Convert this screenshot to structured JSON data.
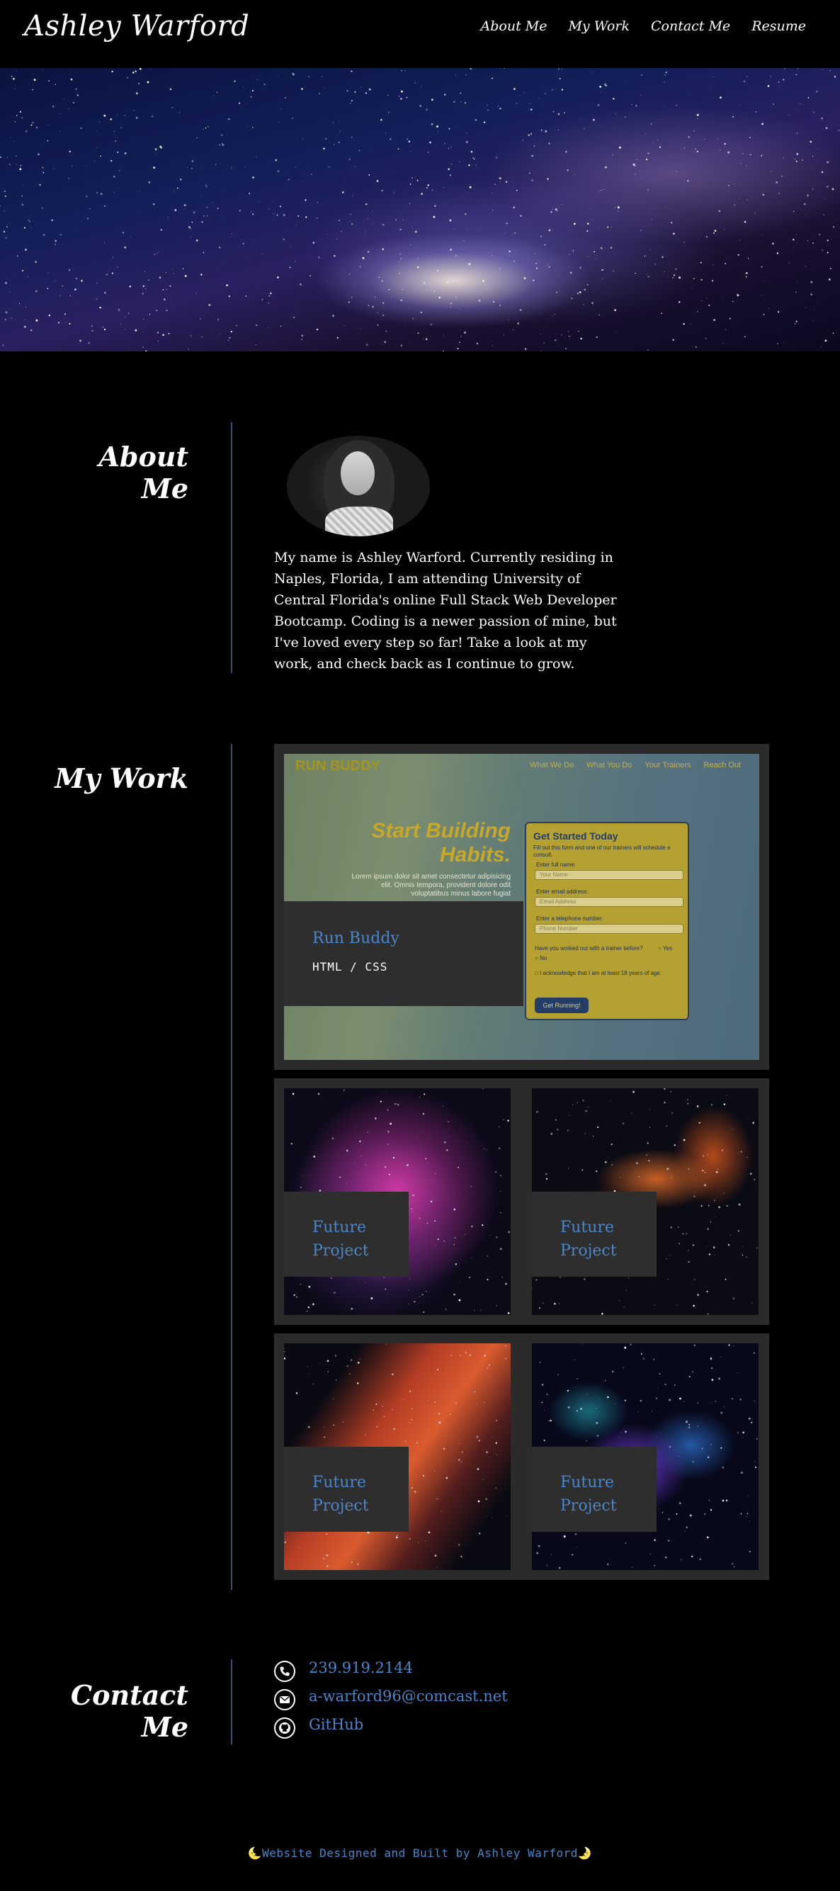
{
  "header": {
    "brand": "Ashley Warford",
    "nav": [
      {
        "label": "About Me"
      },
      {
        "label": "My Work"
      },
      {
        "label": "Contact Me"
      },
      {
        "label": "Resume"
      }
    ]
  },
  "about": {
    "title": "About Me",
    "bio": "My name is Ashley Warford. Currently residing in Naples, Florida, I am attending University of Central Florida's online Full Stack Web Developer Bootcamp. Coding is a newer passion of mine, but I've loved every step so far! Take a look at my work, and check back as I continue to grow."
  },
  "work": {
    "title": "My Work",
    "featured": {
      "name": "Run Buddy",
      "tech": "HTML / CSS",
      "screenshot": {
        "logo": "RUN BUDDY",
        "nav": [
          "What We Do",
          "What You Do",
          "Your Trainers",
          "Reach Out"
        ],
        "headline": "Start Building Habits.",
        "lorem": "Lorem ipsum dolor sit amet consectetur adipisicing elit. Omnis tempora, provident dolore odit voluptatibus minus labore fugiat",
        "form_title": "Get Started Today",
        "form_subtitle": "Fill out this form and one of our trainers will schedule a consult.",
        "full_name_label": "Enter full name:",
        "full_name_placeholder": "Your Name",
        "email_label": "Enter email address:",
        "email_placeholder": "Email Address",
        "phone_label": "Enter a telephone number:",
        "phone_placeholder": "Phone Number",
        "trainer_question": "Have you worked out with a trainer before?",
        "yes": "Yes",
        "no": "No",
        "acknowledge": "I acknowledge that I am at least 18 years of age.",
        "button": "Get Running!"
      }
    },
    "future": [
      {
        "name": "Future Project"
      },
      {
        "name": "Future Project"
      },
      {
        "name": "Future Project"
      },
      {
        "name": "Future Project"
      }
    ]
  },
  "contact": {
    "title": "Contact Me",
    "phone": "239.919.2144",
    "email": "a-warford96@comcast.net",
    "github": "GitHub"
  },
  "footer": {
    "moon_left": "🌜",
    "text": "Website Designed and Built by Ashley Warford",
    "moon_right": "🌛"
  },
  "colors": {
    "background": "#000000",
    "accent_blue": "#4b86c8",
    "card_gray": "#2b2b2b",
    "divider": "#3b4d7a"
  }
}
